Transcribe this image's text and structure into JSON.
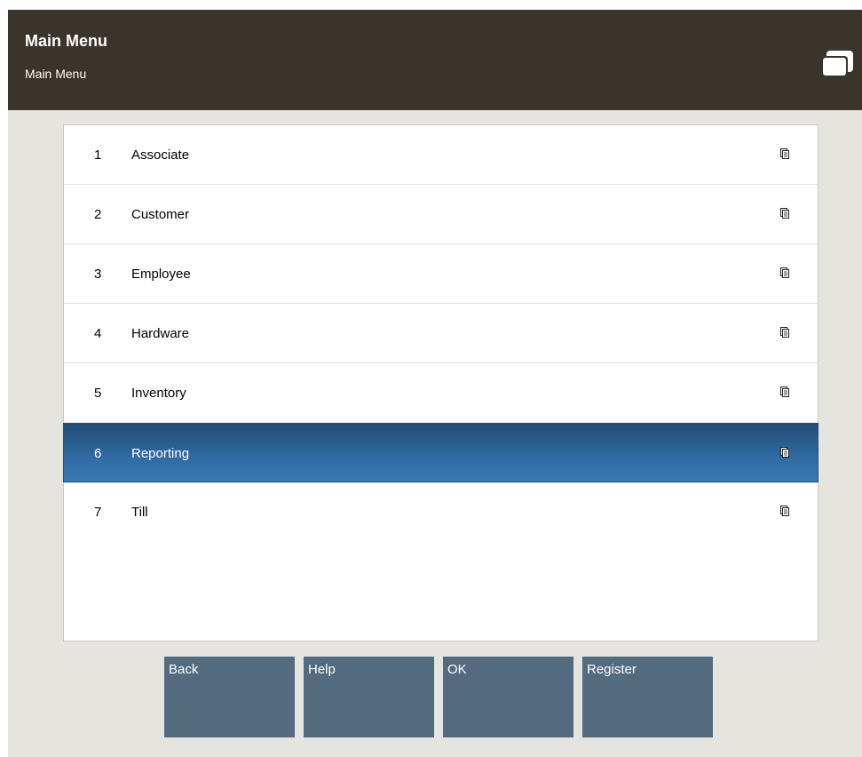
{
  "header": {
    "title": "Main Menu",
    "subtitle": "Main Menu",
    "icon": "stacked-windows-icon"
  },
  "menu": {
    "items": [
      {
        "number": "1",
        "label": "Associate",
        "icon": "document-icon",
        "selected": false
      },
      {
        "number": "2",
        "label": "Customer",
        "icon": "document-icon",
        "selected": false
      },
      {
        "number": "3",
        "label": "Employee",
        "icon": "document-icon",
        "selected": false
      },
      {
        "number": "4",
        "label": "Hardware",
        "icon": "document-icon",
        "selected": false
      },
      {
        "number": "5",
        "label": "Inventory",
        "icon": "document-icon",
        "selected": false
      },
      {
        "number": "6",
        "label": "Reporting",
        "icon": "document-icon",
        "selected": true
      },
      {
        "number": "7",
        "label": "Till",
        "icon": "document-icon",
        "selected": false
      }
    ]
  },
  "footer": {
    "buttons": [
      {
        "label": "Back"
      },
      {
        "label": "Help"
      },
      {
        "label": "OK"
      },
      {
        "label": "Register"
      }
    ]
  },
  "colors": {
    "header_bg": "#3a342b",
    "selected_row": "#2f69a0",
    "button_bg": "#546b7f",
    "page_bg": "#e6e4df"
  }
}
